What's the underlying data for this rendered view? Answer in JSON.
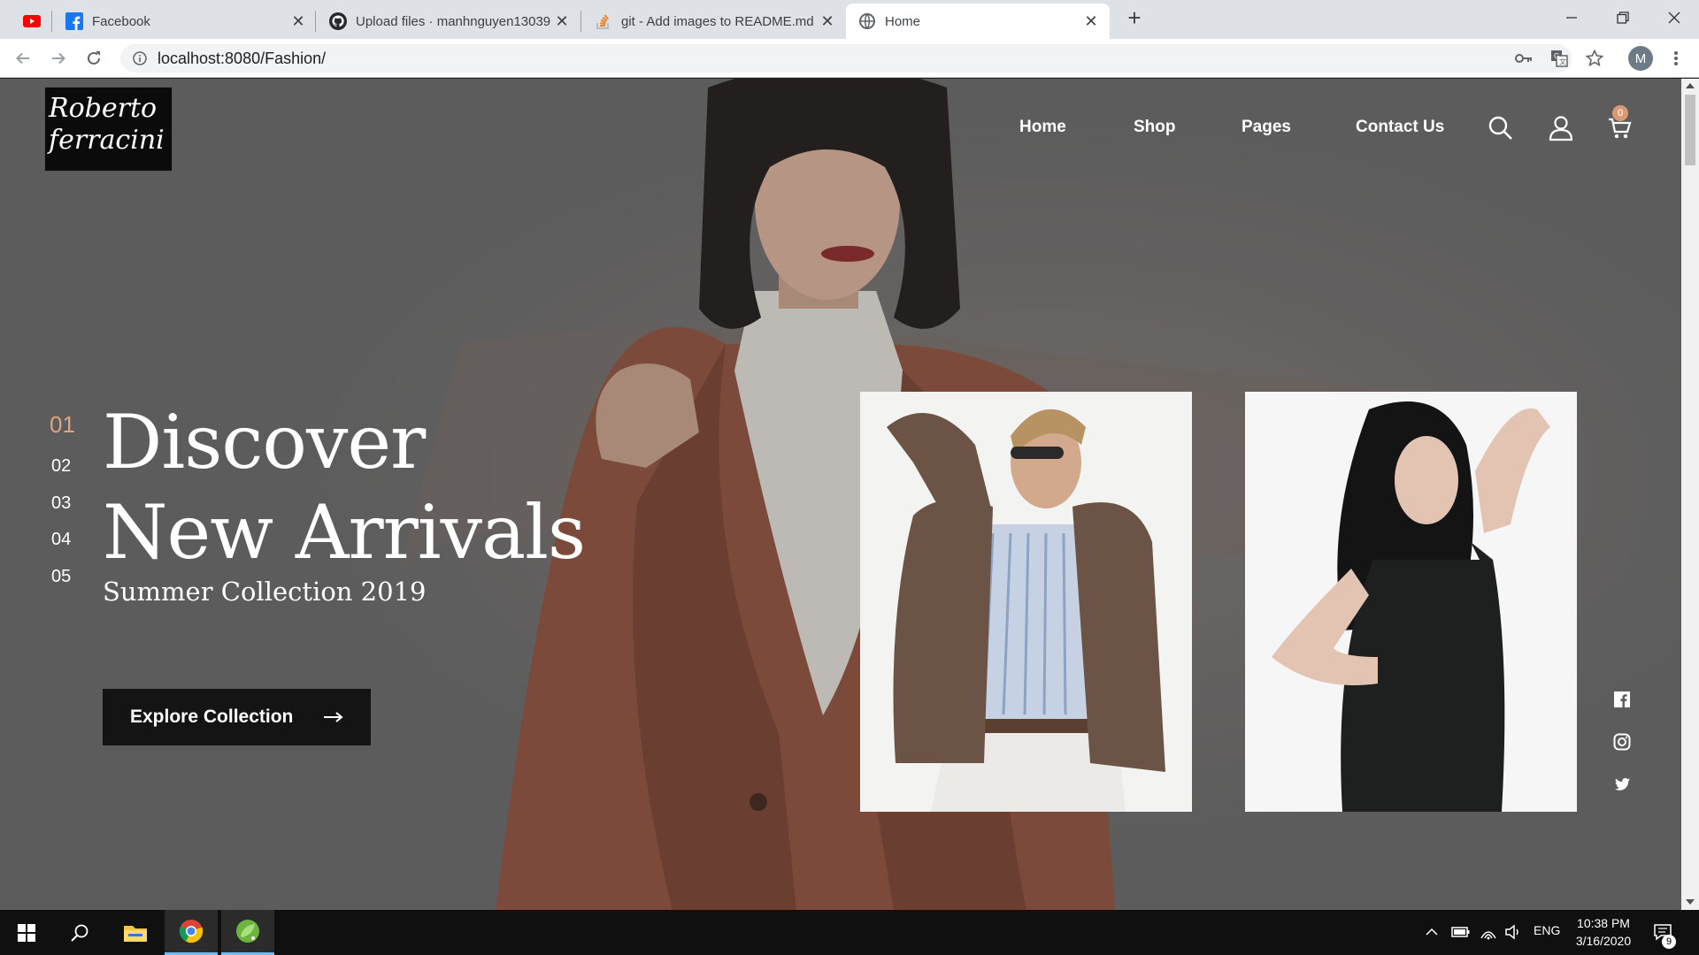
{
  "browser": {
    "tabs": [
      {
        "label": "",
        "icon": "youtube-icon"
      },
      {
        "label": "Facebook",
        "icon": "facebook-icon"
      },
      {
        "label": "Upload files · manhnguyen13039",
        "icon": "github-icon"
      },
      {
        "label": "git - Add images to README.md",
        "icon": "stackoverflow-icon"
      },
      {
        "label": "Home",
        "icon": "globe-icon",
        "active": true
      }
    ],
    "new_tab": "+",
    "url": "localhost:8080/Fashion/",
    "profile_initial": "M"
  },
  "site": {
    "logo_line1": "Roberto",
    "logo_line2": "ferracini",
    "nav": [
      {
        "label": "Home"
      },
      {
        "label": "Shop"
      },
      {
        "label": "Pages"
      },
      {
        "label": "Contact Us"
      }
    ],
    "cart_count": "0"
  },
  "hero": {
    "slides": [
      "01",
      "02",
      "03",
      "04",
      "05"
    ],
    "active_slide": "01",
    "headline_line1": "Discover",
    "headline_line2": "New Arrivals",
    "subtitle": "Summer Collection 2019",
    "cta_label": "Explore Collection",
    "cta_arrow": "→"
  },
  "social": [
    "facebook-icon",
    "instagram-icon",
    "twitter-icon"
  ],
  "taskbar": {
    "language": "ENG",
    "time": "10:38 PM",
    "date": "3/16/2020",
    "notifications": "9"
  },
  "colors": {
    "accent": "#d79c73",
    "hero_overlay": "#5c5c5c",
    "button_bg": "#141414",
    "tab_strip": "#dee1e6"
  }
}
